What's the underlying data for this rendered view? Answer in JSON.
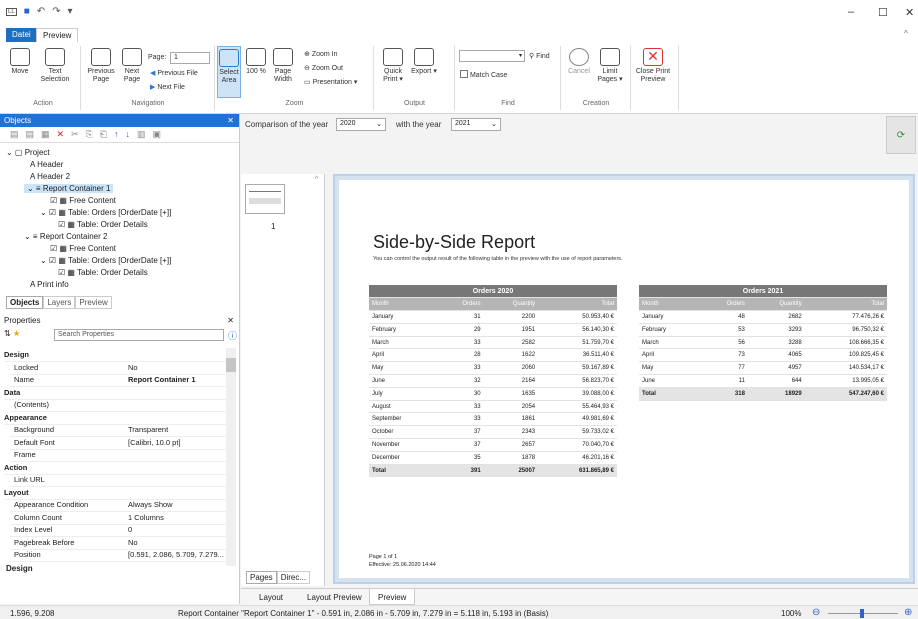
{
  "window": {
    "minimize": "–",
    "maximize": "☐",
    "close": "✕"
  },
  "tabs": {
    "file": "Datei",
    "preview": "Preview"
  },
  "ribbon": {
    "move": "Move",
    "text_selection": "Text Selection",
    "previous_page": "Previous Page",
    "next_page": "Next Page",
    "page_label": "Page:",
    "page_value": "1",
    "previous_file": "Previous File",
    "next_file": "Next File",
    "select_area": "Select Area",
    "zoom100": "100 %",
    "page_width": "Page Width",
    "zoom_in": "Zoom In",
    "zoom_out": "Zoom Out",
    "presentation": "Presentation",
    "quick_print": "Quick Print",
    "export": "Export",
    "match_case": "Match Case",
    "find": "Find",
    "cancel": "Cancel",
    "limit_pages": "Limit Pages",
    "close_print_preview": "Close Print Preview",
    "groups": [
      "Action",
      "Navigation",
      "Zoom",
      "Output",
      "Find",
      "Creation"
    ]
  },
  "objects": {
    "title": "Objects",
    "tree": [
      "Project",
      "Header",
      "Header 2",
      "Report Container 1",
      "Free Content",
      "Table: Orders [OrderDate [+]]",
      "Table: Order Details",
      "Report Container 2",
      "Free Content",
      "Table: Orders [OrderDate [+]]",
      "Table: Order Details",
      "Print info"
    ],
    "tabs": [
      "Objects",
      "Layers",
      "Preview"
    ]
  },
  "properties": {
    "title": "Properties",
    "search_placeholder": "Search Properties",
    "rows": [
      {
        "k": "Design",
        "v": "",
        "cat": true
      },
      {
        "k": "Locked",
        "v": "No"
      },
      {
        "k": "Name",
        "v": "Report Container 1",
        "bold": true
      },
      {
        "k": "Data",
        "v": "",
        "cat": true
      },
      {
        "k": "(Contents)",
        "v": ""
      },
      {
        "k": "Appearance",
        "v": "",
        "cat": true
      },
      {
        "k": "Background",
        "v": "Transparent"
      },
      {
        "k": "Default Font",
        "v": "[Calibri, 10.0 pt]"
      },
      {
        "k": "Frame",
        "v": ""
      },
      {
        "k": "Action",
        "v": "",
        "cat": true
      },
      {
        "k": "Link URL",
        "v": ""
      },
      {
        "k": "Layout",
        "v": "",
        "cat": true
      },
      {
        "k": "Appearance Condition",
        "v": "Always Show"
      },
      {
        "k": "Column Count",
        "v": "1 Columns"
      },
      {
        "k": "Index Level",
        "v": "0"
      },
      {
        "k": "Pagebreak Before",
        "v": "No"
      },
      {
        "k": "Position",
        "v": "[0.591, 2.086, 5.709, 7.279..."
      }
    ],
    "footer": "Design"
  },
  "preview": {
    "comparison_label": "Comparison of the year",
    "year1": "2020",
    "with_label": "with the year",
    "year2": "2021",
    "thumb_page": "1",
    "pages_tab": "Pages",
    "direct_tab": "Direc..."
  },
  "report": {
    "title": "Side-by-Side Report",
    "subtitle": "You can control the output result of the following table in the preview with the use of report parameters.",
    "footer1": "Page 1 of 1",
    "footer2": "Effective: 25.06.2020 14:44"
  },
  "table2020": {
    "title": "Orders 2020",
    "headers": [
      "Month",
      "Orders",
      "Quantity",
      "Total"
    ],
    "rows": [
      [
        "January",
        "31",
        "2200",
        "50.953,40 €"
      ],
      [
        "February",
        "29",
        "1951",
        "56.140,30 €"
      ],
      [
        "March",
        "33",
        "2582",
        "51.759,70 €"
      ],
      [
        "April",
        "28",
        "1622",
        "36.511,40 €"
      ],
      [
        "May",
        "33",
        "2060",
        "59.167,89 €"
      ],
      [
        "June",
        "32",
        "2164",
        "56.823,70 €"
      ],
      [
        "July",
        "30",
        "1635",
        "39.088,00 €"
      ],
      [
        "August",
        "33",
        "2054",
        "55.464,93 €"
      ],
      [
        "September",
        "33",
        "1861",
        "49.981,69 €"
      ],
      [
        "October",
        "37",
        "2343",
        "59.733,02 €"
      ],
      [
        "November",
        "37",
        "2657",
        "70.040,70 €"
      ],
      [
        "December",
        "35",
        "1878",
        "46.201,16 €"
      ]
    ],
    "total": [
      "Total",
      "391",
      "25007",
      "631.865,89 €"
    ]
  },
  "table2021": {
    "title": "Orders 2021",
    "headers": [
      "Month",
      "Orders",
      "Quantity",
      "Total"
    ],
    "rows": [
      [
        "January",
        "48",
        "2682",
        "77.476,26 €"
      ],
      [
        "February",
        "53",
        "3293",
        "96.750,32 €"
      ],
      [
        "March",
        "56",
        "3288",
        "108.666,35 €"
      ],
      [
        "April",
        "73",
        "4065",
        "109.825,45 €"
      ],
      [
        "May",
        "77",
        "4957",
        "140.534,17 €"
      ],
      [
        "June",
        "11",
        "644",
        "13.995,05 €"
      ]
    ],
    "total": [
      "Total",
      "318",
      "18929",
      "547.247,60 €"
    ]
  },
  "bottom_tabs": [
    "Layout",
    "Layout Preview",
    "Preview"
  ],
  "status": {
    "coords": "1.596, 9.208",
    "info": "Report Container \"Report Container 1\" - 0.591 in, 2.086 in - 5.709 in, 7.279 in = 5.118 in, 5.193 in (Basis)",
    "zoom": "100%"
  }
}
